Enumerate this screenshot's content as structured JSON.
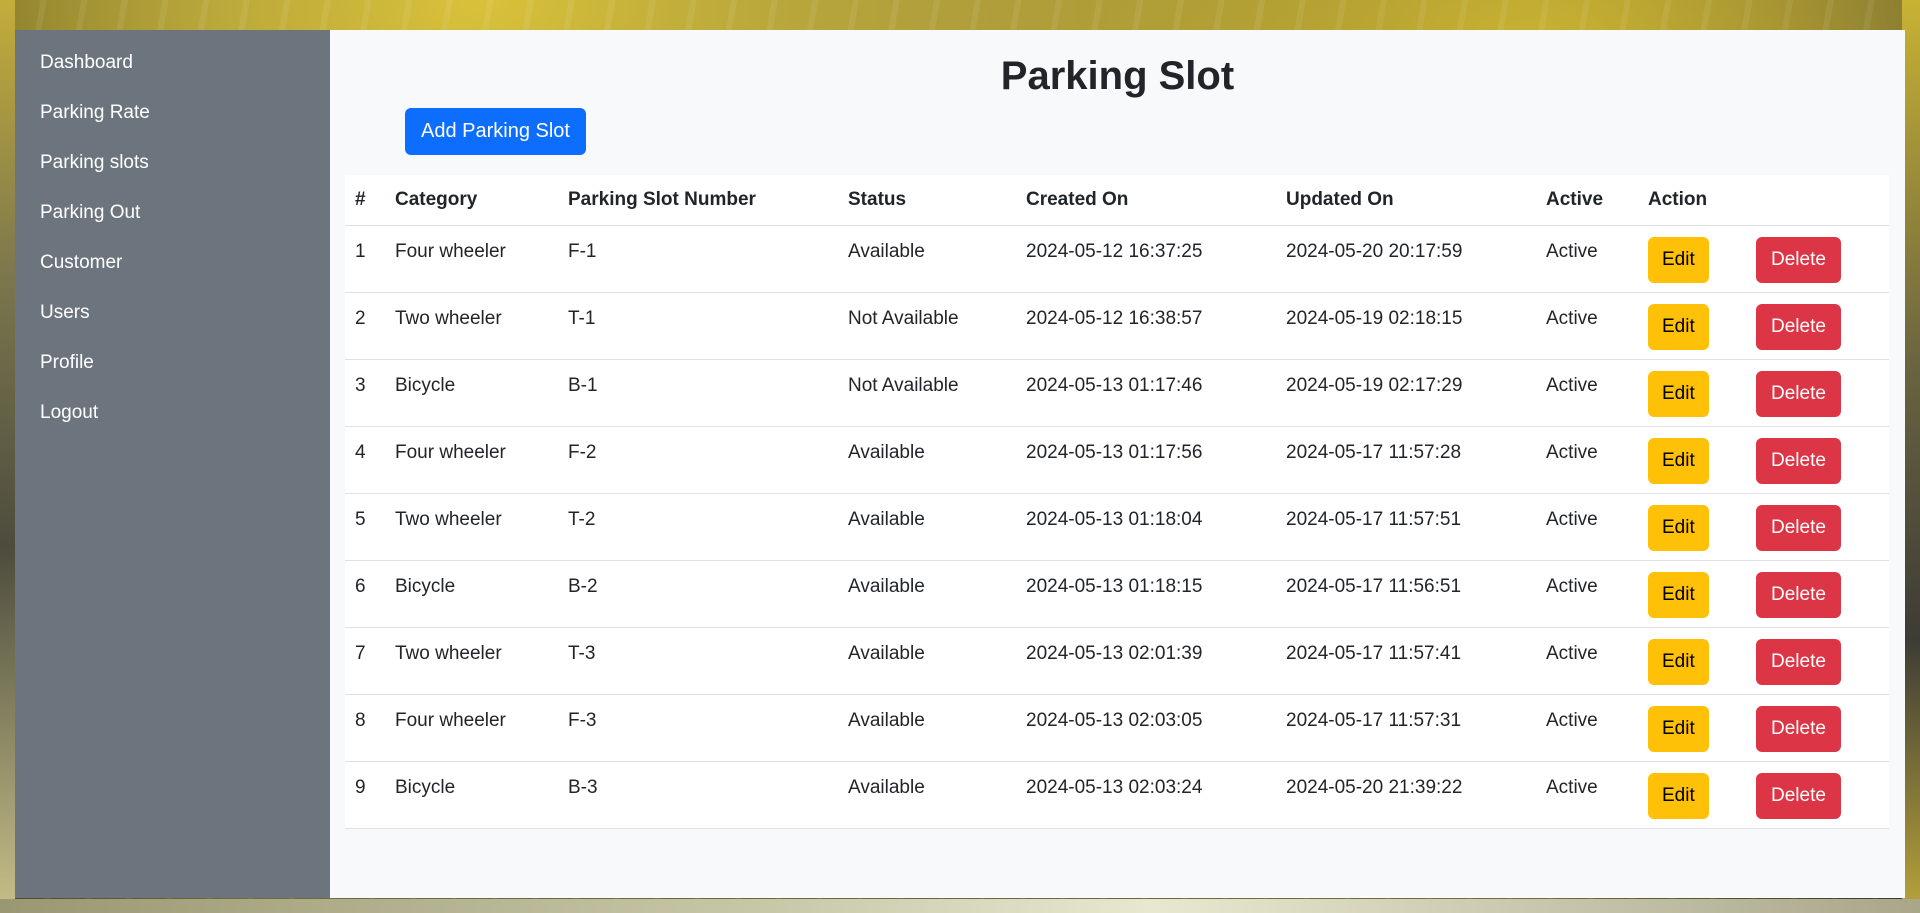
{
  "sidebar": {
    "items": [
      {
        "label": "Dashboard"
      },
      {
        "label": "Parking Rate"
      },
      {
        "label": "Parking slots"
      },
      {
        "label": "Parking Out"
      },
      {
        "label": "Customer"
      },
      {
        "label": "Users"
      },
      {
        "label": "Profile"
      },
      {
        "label": "Logout"
      }
    ]
  },
  "main": {
    "title": "Parking Slot",
    "add_button_label": "Add Parking Slot"
  },
  "table": {
    "headers": [
      "#",
      "Category",
      "Parking Slot Number",
      "Status",
      "Created On",
      "Updated On",
      "Active",
      "Action"
    ],
    "edit_label": "Edit",
    "delete_label": "Delete",
    "rows": [
      {
        "num": "1",
        "category": "Four wheeler",
        "slot": "F-1",
        "status": "Available",
        "created": "2024-05-12 16:37:25",
        "updated": "2024-05-20 20:17:59",
        "active": "Active"
      },
      {
        "num": "2",
        "category": "Two wheeler",
        "slot": "T-1",
        "status": "Not Available",
        "created": "2024-05-12 16:38:57",
        "updated": "2024-05-19 02:18:15",
        "active": "Active"
      },
      {
        "num": "3",
        "category": "Bicycle",
        "slot": "B-1",
        "status": "Not Available",
        "created": "2024-05-13 01:17:46",
        "updated": "2024-05-19 02:17:29",
        "active": "Active"
      },
      {
        "num": "4",
        "category": "Four wheeler",
        "slot": "F-2",
        "status": "Available",
        "created": "2024-05-13 01:17:56",
        "updated": "2024-05-17 11:57:28",
        "active": "Active"
      },
      {
        "num": "5",
        "category": "Two wheeler",
        "slot": "T-2",
        "status": "Available",
        "created": "2024-05-13 01:18:04",
        "updated": "2024-05-17 11:57:51",
        "active": "Active"
      },
      {
        "num": "6",
        "category": "Bicycle",
        "slot": "B-2",
        "status": "Available",
        "created": "2024-05-13 01:18:15",
        "updated": "2024-05-17 11:56:51",
        "active": "Active"
      },
      {
        "num": "7",
        "category": "Two wheeler",
        "slot": "T-3",
        "status": "Available",
        "created": "2024-05-13 02:01:39",
        "updated": "2024-05-17 11:57:41",
        "active": "Active"
      },
      {
        "num": "8",
        "category": "Four wheeler",
        "slot": "F-3",
        "status": "Available",
        "created": "2024-05-13 02:03:05",
        "updated": "2024-05-17 11:57:31",
        "active": "Active"
      },
      {
        "num": "9",
        "category": "Bicycle",
        "slot": "B-3",
        "status": "Available",
        "created": "2024-05-13 02:03:24",
        "updated": "2024-05-20 21:39:22",
        "active": "Active"
      }
    ]
  },
  "colors": {
    "sidebar_bg": "#6c757d",
    "primary": "#0d6efd",
    "warning": "#ffc107",
    "danger": "#dc3545",
    "main_bg": "#f8f9fa"
  }
}
